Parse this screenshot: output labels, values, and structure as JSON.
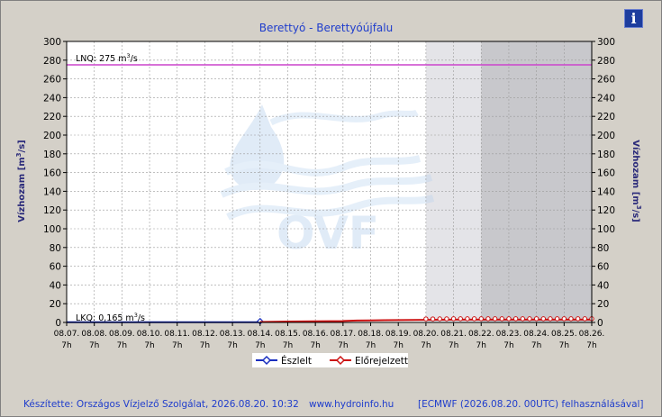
{
  "chart_data": {
    "type": "line",
    "title": "Berettyó - Berettyóújfalu",
    "ylabel": "Vízhozam [m",
    "ylabel_sup": "3",
    "ylabel_tail": "/s]",
    "ylim": [
      0,
      300
    ],
    "yticks": [
      0,
      20,
      40,
      60,
      80,
      100,
      120,
      140,
      160,
      180,
      200,
      220,
      240,
      260,
      280,
      300
    ],
    "x_dates": [
      "08.07.",
      "08.08.",
      "08.09.",
      "08.10.",
      "08.11.",
      "08.12.",
      "08.13.",
      "08.14.",
      "08.15.",
      "08.16.",
      "08.17.",
      "08.18.",
      "08.19.",
      "08.20.",
      "08.21.",
      "08.22.",
      "08.23.",
      "08.24.",
      "08.25.",
      "08.26."
    ],
    "x_hours": [
      "7h",
      "7h",
      "7h",
      "7h",
      "7h",
      "7h",
      "7h",
      "7h",
      "7h",
      "7h",
      "7h",
      "7h",
      "7h",
      "7h",
      "7h",
      "7h",
      "7h",
      "7h",
      "7h",
      "7h"
    ],
    "grid": true,
    "shaded_regions": [
      {
        "from": "08.20. 7h",
        "to": "08.22. 7h",
        "color": "#e4e4e8"
      },
      {
        "from": "08.22. 7h",
        "to": "08.26. 7h",
        "color": "#c8c8cc"
      }
    ],
    "reference_lines": [
      {
        "name": "LNQ",
        "value": 275,
        "label": "LNQ: 275",
        "unit": "m",
        "unit_sup": "3",
        "unit_tail": "/s",
        "color": "#cc44cc"
      },
      {
        "name": "LKQ",
        "value": 0.165,
        "label": "LKQ: 0,165",
        "unit": "m",
        "unit_sup": "3",
        "unit_tail": "/s",
        "color": "#000000"
      }
    ],
    "series": [
      {
        "name": "Észlelt",
        "color": "#1a2fbf",
        "x_day": [
          0,
          1,
          2,
          3,
          4,
          5,
          6,
          7
        ],
        "values": [
          0.3,
          0.3,
          0.3,
          0.3,
          0.3,
          0.3,
          0.3,
          0.3
        ]
      },
      {
        "name": "Előrejelzett",
        "color": "#cc1111",
        "x_day": [
          7,
          8,
          9,
          10,
          10.5,
          11,
          11.5,
          12,
          12.5,
          13,
          13.25,
          13.5,
          13.75,
          14,
          14.25,
          14.5,
          14.75,
          15,
          15.25,
          15.5,
          15.75,
          16,
          16.25,
          16.5,
          16.75,
          17,
          17.25,
          17.5,
          17.75,
          18,
          18.25,
          18.5,
          18.75,
          19
        ],
        "values": [
          0.5,
          1.0,
          1.2,
          1.5,
          2.0,
          2.2,
          2.4,
          2.5,
          2.6,
          2.8,
          2.8,
          2.9,
          2.9,
          3.0,
          3.0,
          3.0,
          3.0,
          3.0,
          3.0,
          3.0,
          3.0,
          3.0,
          3.0,
          3.0,
          3.0,
          3.0,
          3.0,
          3.0,
          3.0,
          3.0,
          3.0,
          3.0,
          3.0,
          3.0
        ]
      }
    ],
    "legend": {
      "placement": "bottom-center"
    }
  },
  "watermark": {
    "text": "OVF"
  },
  "footer": {
    "made_by": "Készítette: Országos Vízjelző Szolgálat, 2026.08.20. 10:32",
    "website": "www.hydroinfo.hu",
    "model_note": "[ECMWF (2026.08.20. 00UTC) felhasználásával]"
  },
  "info_button": {
    "label": "i"
  },
  "colors": {
    "title": "#1f3dcc",
    "footer": "#1f3dcc",
    "background": "#d4d0c8",
    "plot": "#ffffff"
  }
}
